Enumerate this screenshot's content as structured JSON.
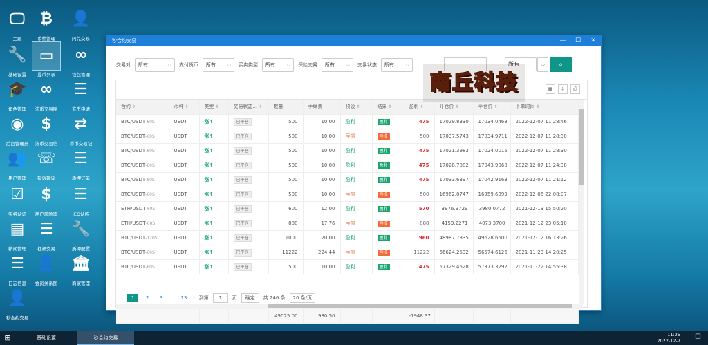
{
  "desktop_icons": [
    {
      "label": "主题",
      "glyph": "monitor-icon"
    },
    {
      "label": "币种管理",
      "glyph": "bitcoin-icon"
    },
    {
      "label": "闪兑交易",
      "glyph": "add-user-icon"
    },
    {
      "label": "基础设置",
      "glyph": "wrench-icon"
    },
    {
      "label": "提币列表",
      "glyph": "card-icon"
    },
    {
      "label": "钱包管理",
      "glyph": "link-icon"
    },
    {
      "label": "角色管理",
      "glyph": "grad-cap-icon"
    },
    {
      "label": "法币交易圈",
      "glyph": "link-icon"
    },
    {
      "label": "充币申请",
      "glyph": "list-icon"
    },
    {
      "label": "后台管理员",
      "glyph": "user-circle-icon"
    },
    {
      "label": "法币交易信",
      "glyph": "dollar-icon"
    },
    {
      "label": "币币交易记",
      "glyph": "swap-icon"
    },
    {
      "label": "用户管理",
      "glyph": "users-icon"
    },
    {
      "label": "投诉建议",
      "glyph": "phone-icon"
    },
    {
      "label": "质押订单",
      "glyph": "list-icon"
    },
    {
      "label": "实名认证",
      "glyph": "check-icon"
    },
    {
      "label": "用户风险率",
      "glyph": "dollar-icon"
    },
    {
      "label": "IEO认购",
      "glyph": "list-icon"
    },
    {
      "label": "新闻管理",
      "glyph": "news-icon"
    },
    {
      "label": "杠杆交易",
      "glyph": "list-icon"
    },
    {
      "label": "质押配置",
      "glyph": "wrench-icon"
    },
    {
      "label": "日志信息",
      "glyph": "list-icon"
    },
    {
      "label": "会员关系图",
      "glyph": "add-user-icon"
    },
    {
      "label": "商家管理",
      "glyph": "bank-icon"
    },
    {
      "label": "秒合约交易",
      "glyph": "add-user-icon"
    }
  ],
  "window": {
    "title": "秒合约交易",
    "ctrl_min": "—",
    "ctrl_max": "☐",
    "ctrl_close": "✕"
  },
  "filters": [
    {
      "label": "交易对",
      "value": "所有"
    },
    {
      "label": "支付货币",
      "value": "所有"
    },
    {
      "label": "买卖类型",
      "value": "所有"
    },
    {
      "label": "保险交易",
      "value": "所有"
    },
    {
      "label": "交易状态",
      "value": "所有"
    }
  ],
  "filter_extra_value": "所有",
  "search_icon": "search-icon",
  "columns": [
    "合约",
    "币种",
    "类型",
    "交易状态...",
    "数量",
    "手续费",
    "预设",
    "结果",
    "盈利",
    "开仓价",
    "平仓价",
    "下单时间"
  ],
  "rows": [
    {
      "symbol": "BTC/USDT",
      "period": "-60S",
      "currency": "USDT",
      "type": "涨",
      "status": "已平仓",
      "qty": "500",
      "fee": "10.00",
      "preset": "盈利",
      "result": "盈利",
      "profit": "475",
      "open": "17029.8330",
      "close": "17034.0463",
      "time": "2022-12-07 11:28:46"
    },
    {
      "symbol": "BTC/USDT",
      "period": "-60S",
      "currency": "USDT",
      "type": "涨",
      "status": "已平仓",
      "qty": "500",
      "fee": "10.00",
      "preset": "亏损",
      "result": "亏损",
      "profit": "-500",
      "open": "17037.5743",
      "close": "17034.9711",
      "time": "2022-12-07 11:28:30"
    },
    {
      "symbol": "BTC/USDT",
      "period": "-60S",
      "currency": "USDT",
      "type": "涨",
      "status": "已平仓",
      "qty": "500",
      "fee": "10.00",
      "preset": "盈利",
      "result": "盈利",
      "profit": "475",
      "open": "17021.3983",
      "close": "17024.0015",
      "time": "2022-12-07 11:28:30"
    },
    {
      "symbol": "BTC/USDT",
      "period": "-60S",
      "currency": "USDT",
      "type": "涨",
      "status": "已平仓",
      "qty": "500",
      "fee": "10.00",
      "preset": "盈利",
      "result": "盈利",
      "profit": "475",
      "open": "17028.7082",
      "close": "17043.9068",
      "time": "2022-12-07 11:24:38"
    },
    {
      "symbol": "BTC/USDT",
      "period": "-60S",
      "currency": "USDT",
      "type": "涨",
      "status": "已平仓",
      "qty": "500",
      "fee": "10.00",
      "preset": "盈利",
      "result": "盈利",
      "profit": "475",
      "open": "17033.6397",
      "close": "17042.9163",
      "time": "2022-12-07 11:21:12"
    },
    {
      "symbol": "BTC/USDT",
      "period": "-60S",
      "currency": "USDT",
      "type": "涨",
      "status": "已平仓",
      "qty": "500",
      "fee": "10.00",
      "preset": "亏损",
      "result": "亏损",
      "profit": "-500",
      "open": "16962.0747",
      "close": "16959.6399",
      "time": "2022-12-06 22:08:07"
    },
    {
      "symbol": "ETH/USDT",
      "period": "-60S",
      "currency": "USDT",
      "type": "涨",
      "status": "已平仓",
      "qty": "600",
      "fee": "12.00",
      "preset": "盈利",
      "result": "盈利",
      "profit": "570",
      "open": "3976.9729",
      "close": "3980.0772",
      "time": "2021-12-13 15:50:20"
    },
    {
      "symbol": "ETH/USDT",
      "period": "-60S",
      "currency": "USDT",
      "type": "涨",
      "status": "已平仓",
      "qty": "888",
      "fee": "17.76",
      "preset": "亏损",
      "result": "亏损",
      "profit": "-888",
      "open": "4159.2271",
      "close": "4073.3700",
      "time": "2021-12-12 23:05:10"
    },
    {
      "symbol": "BTC/USDT",
      "period": "-120S",
      "currency": "USDT",
      "type": "涨",
      "status": "已平仓",
      "qty": "1000",
      "fee": "20.00",
      "preset": "盈利",
      "result": "盈利",
      "profit": "960",
      "open": "48987.7335",
      "close": "49628.6500",
      "time": "2021-12-12 16:13:26"
    },
    {
      "symbol": "BTC/USDT",
      "period": "-60S",
      "currency": "USDT",
      "type": "涨",
      "status": "已平仓",
      "qty": "11222",
      "fee": "224.44",
      "preset": "亏损",
      "result": "亏损",
      "profit": "-11222",
      "open": "56624.2532",
      "close": "56574.6126",
      "time": "2021-11-23 14:20:25"
    },
    {
      "symbol": "BTC/USDT",
      "period": "-60S",
      "currency": "USDT",
      "type": "涨",
      "status": "已平仓",
      "qty": "500",
      "fee": "10.00",
      "preset": "盈利",
      "result": "盈利",
      "profit": "475",
      "open": "57329.4528",
      "close": "57373.3292",
      "time": "2021-11-22 14:55:38"
    }
  ],
  "totals": {
    "qty": "49025.00",
    "fee": "980.50",
    "profit": "-1948.37"
  },
  "pager": {
    "prev": "‹",
    "pages": [
      "1",
      "2",
      "3"
    ],
    "ellipsis": "...",
    "last": "13",
    "next": "›",
    "goto_label": "到第",
    "goto_value": "1",
    "page_unit": "页",
    "confirm": "确定",
    "total": "共 246 条",
    "per_page": "20 条/页"
  },
  "watermark": "南丘科技",
  "taskbar": {
    "start_icon": "windows-icon",
    "tasks": [
      "基础设置",
      "秒合约交易"
    ],
    "time": "11:25",
    "date": "2022-12-7",
    "notif_icon": "notification-icon"
  }
}
